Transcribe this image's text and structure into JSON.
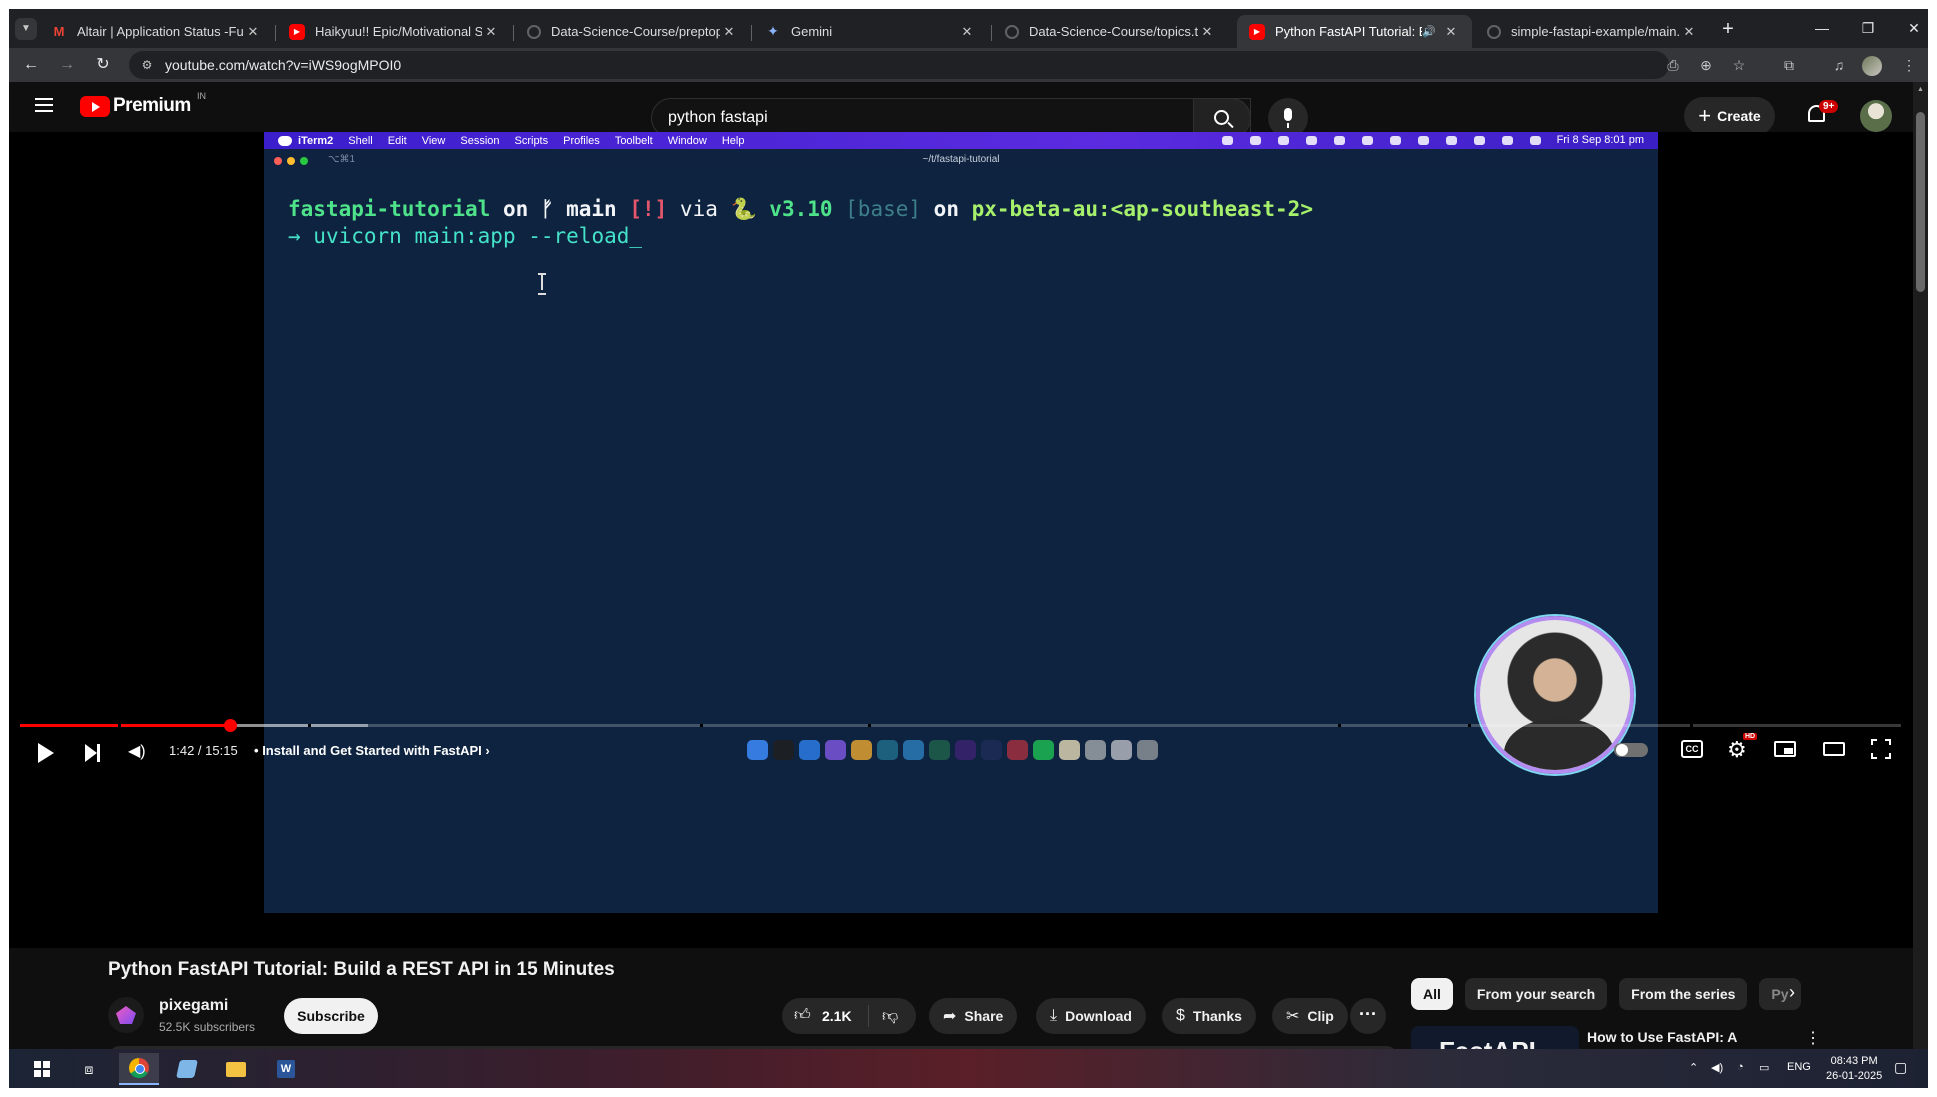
{
  "browser": {
    "tabs": [
      {
        "title": "Altair | Application Status -Fullst",
        "favicon": "gmail-icon",
        "active": false
      },
      {
        "title": "Haikyuu!! Epic/Motivational Sou",
        "favicon": "youtube-icon",
        "active": false
      },
      {
        "title": "Data-Science-Course/preptopic",
        "favicon": "github-icon",
        "active": false
      },
      {
        "title": "Gemini",
        "favicon": "gemini-icon",
        "active": false
      },
      {
        "title": "Data-Science-Course/topics.txt",
        "favicon": "github-icon",
        "active": false
      },
      {
        "title": "Python FastAPI Tutorial: Bu",
        "favicon": "youtube-icon",
        "active": true,
        "audio": true
      },
      {
        "title": "simple-fastapi-example/main.p",
        "favicon": "github-icon",
        "active": false
      }
    ],
    "url": "youtube.com/watch?v=iWS9ogMPOI0"
  },
  "youtube": {
    "logo_text": "Premium",
    "country_code": "IN",
    "search_value": "python fastapi",
    "create_label": "Create",
    "notification_badge": "9+"
  },
  "video_frame": {
    "menubar": {
      "app": "iTerm2",
      "items": [
        "Shell",
        "Edit",
        "View",
        "Session",
        "Scripts",
        "Profiles",
        "Toolbelt",
        "Window",
        "Help"
      ],
      "clock": "Fri 8 Sep  8:01 pm"
    },
    "terminal": {
      "shortcut": "⌥⌘1",
      "path": "~/t/fastapi-tutorial",
      "line1": {
        "dir": "fastapi-tutorial",
        "on1": " on ",
        "branch_icon": "ᚠ",
        "branch": " main",
        "status": " [!]",
        "via": " via ",
        "py_icon": "🐍",
        "pyver": " v3.10",
        "env": " [base]",
        "on2": " on ",
        "context": "px-beta-au:<ap-southeast-2>"
      },
      "line2": {
        "arrow": "→",
        "command": " uvicorn main:app --reload_"
      }
    }
  },
  "player": {
    "time": "1:42 / 15:15",
    "separator": "•",
    "chapter": "Install and Get Started with FastAPI",
    "progress_fraction": 0.1115,
    "buffered_fraction": 0.185,
    "cc_label": "CC",
    "hd_badge": "HD"
  },
  "video": {
    "title": "Python FastAPI Tutorial: Build a REST API in 15 Minutes",
    "channel": "pixegami",
    "subscribers": "52.5K subscribers",
    "subscribe_label": "Subscribe",
    "likes": "2.1K",
    "share_label": "Share",
    "download_label": "Download",
    "thanks_label": "Thanks",
    "clip_label": "Clip"
  },
  "recommendations": {
    "chips": [
      "All",
      "From your search",
      "From the series",
      "Py"
    ],
    "first": {
      "thumb_text": "FastAPI",
      "title": "How to Use FastAPI: A Detailed Python Tutorial"
    }
  },
  "taskbar": {
    "lang": "ENG",
    "time": "08:43 PM",
    "date": "26-01-2025"
  },
  "colors": {
    "youtube_red": "#ff0000",
    "terminal_bg": "#0e2340",
    "menubar": "#4a24d8"
  }
}
